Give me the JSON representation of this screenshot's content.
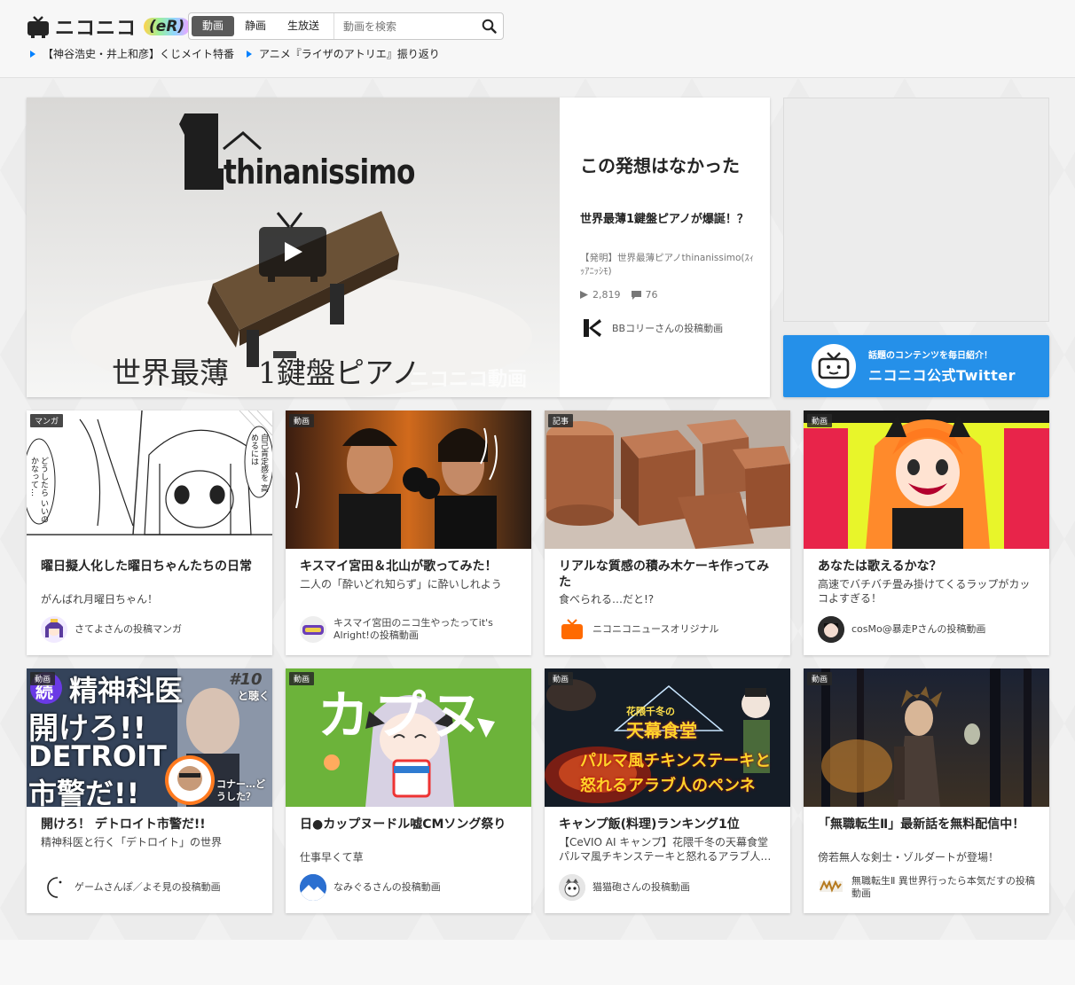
{
  "header": {
    "logo_text": "ニコニコ",
    "logo_suffix": "(eR)",
    "tabs": [
      "動画",
      "静画",
      "生放送"
    ],
    "search_placeholder": "動画を検索",
    "news": [
      "【神谷浩史・井上和彦】くじメイト特番",
      "アニメ『ライザのアトリエ』振り返り"
    ]
  },
  "hero": {
    "thumb_text_top": "thinanissimo",
    "thumb_text_bottom": "世界最薄　1鍵盤ピアノ",
    "watermark": "ニコニコ動画",
    "title": "この発想はなかった",
    "subtitle": "世界最薄1鍵盤ピアノが爆誕！？",
    "description": "【発明】世界最薄ピアノthinanissimo(ｽｨｯｱﾆｯｼﾓ)",
    "views": "2,819",
    "comments": "76",
    "author": "BBコリーさんの投稿動画"
  },
  "twitter": {
    "small": "話題のコンテンツを毎日紹介！",
    "big": "ニコニコ公式Twitter"
  },
  "cards": [
    {
      "tag": "マンガ",
      "title": "曜日擬人化した曜日ちゃんたちの日常",
      "sub": "がんばれ月曜日ちゃん！",
      "author": "さてよさんの投稿マンガ",
      "bubble1": "どうしたら いいのかなって…",
      "bubble2": "自己肯定感を 高めるには"
    },
    {
      "tag": "動画",
      "title": "キスマイ宮田＆北山が歌ってみた！",
      "sub": "二人の「酔いどれ知らず」に酔いしれよう",
      "author": "キスマイ宮田のニコ生やったってit's Alright!の投稿動画"
    },
    {
      "tag": "記事",
      "title": "リアルな質感の積み木ケーキ作ってみた",
      "sub": "食べられる…だと!?",
      "author": "ニコニコニュースオリジナル"
    },
    {
      "tag": "動画",
      "title": "あなたは歌えるかな？",
      "sub": "高速でバチバチ畳み掛けてくるラップがカッコよすぎる！",
      "author": "cosMo@暴走Pさんの投稿動画"
    },
    {
      "tag": "動画",
      "title": "開けろ！ デトロイト市警だ!!",
      "sub": "精神科医と行く「デトロイト」の世界",
      "author": "ゲームさんぽ／よそ見の投稿動画",
      "thumb_l1": "精神科医",
      "thumb_l2": "開けろ!!",
      "thumb_l3": "DETROIT",
      "thumb_l4": "市警だ!!",
      "thumb_badge": "続",
      "thumb_num": "#10",
      "thumb_corner": "と聴く",
      "thumb_small": "コナー…どうした？"
    },
    {
      "tag": "動画",
      "title": "日●カップヌードル嘘CMソング祭り",
      "sub": "仕事早くて草",
      "author": "なみぐるさんの投稿動画",
      "thumb_text": "カプヌ"
    },
    {
      "tag": "動画",
      "title": "キャンプ飯(料理)ランキング1位",
      "sub": "【CeVIO AI キャンプ】花隈千冬の天幕食堂 パルマ風チキンステーキと怒れるアラブ人…",
      "author": "猫猫砲さんの投稿動画",
      "thumb_l1": "花隈千冬の",
      "thumb_l2": "天幕食堂",
      "thumb_l3": "パルマ風チキンステーキと",
      "thumb_l4": "怒れるアラブ人のペンネ"
    },
    {
      "tag": "動画",
      "title": "「無職転生Ⅱ」最新話を無料配信中！",
      "sub": "傍若無人な剣士・ゾルダートが登場！",
      "author": "無職転生Ⅱ 異世界行ったら本気だすの投稿動画"
    }
  ],
  "colors": {
    "accent_blue": "#2590e9",
    "news_triangle": "#0080ff",
    "tab_active": "#5a5a5a"
  }
}
